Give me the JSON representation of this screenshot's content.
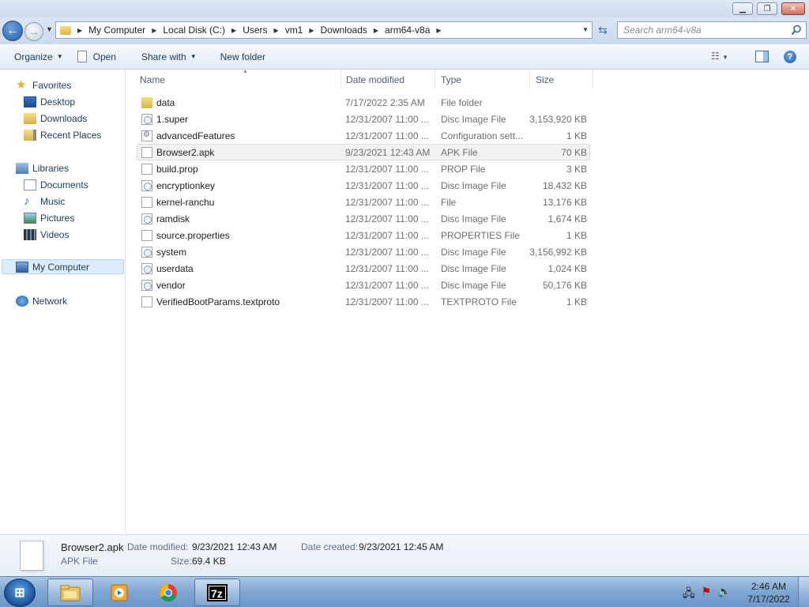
{
  "window": {
    "min_icon": "minimize-icon",
    "max_icon": "restore-icon",
    "close_icon": "close-icon"
  },
  "address": {
    "breadcrumbs": [
      "My Computer",
      "Local Disk (C:)",
      "Users",
      "vm1",
      "Downloads",
      "arm64-v8a"
    ]
  },
  "search": {
    "placeholder": "Search arm64-v8a"
  },
  "toolbar": {
    "organize": "Organize",
    "open": "Open",
    "share_with": "Share with",
    "new_folder": "New folder"
  },
  "nav": {
    "favorites": "Favorites",
    "desktop": "Desktop",
    "downloads": "Downloads",
    "recent_places": "Recent Places",
    "libraries": "Libraries",
    "documents": "Documents",
    "music": "Music",
    "pictures": "Pictures",
    "videos": "Videos",
    "my_computer": "My Computer",
    "network": "Network"
  },
  "columns": {
    "name": "Name",
    "date": "Date modified",
    "type": "Type",
    "size": "Size"
  },
  "files": [
    {
      "name": "data",
      "date": "7/17/2022 2:35 AM",
      "type": "File folder",
      "size": "",
      "icon": "folder-icon"
    },
    {
      "name": "1.super",
      "date": "12/31/2007 11:00 ...",
      "type": "Disc Image File",
      "size": "3,153,920 KB",
      "icon": "disc-image-icon"
    },
    {
      "name": "advancedFeatures",
      "date": "12/31/2007 11:00 ...",
      "type": "Configuration sett...",
      "size": "1 KB",
      "icon": "config-file-icon"
    },
    {
      "name": "Browser2.apk",
      "date": "9/23/2021 12:43 AM",
      "type": "APK File",
      "size": "70 KB",
      "icon": "file-icon"
    },
    {
      "name": "build.prop",
      "date": "12/31/2007 11:00 ...",
      "type": "PROP File",
      "size": "3 KB",
      "icon": "file-icon"
    },
    {
      "name": "encryptionkey",
      "date": "12/31/2007 11:00 ...",
      "type": "Disc Image File",
      "size": "18,432 KB",
      "icon": "disc-image-icon"
    },
    {
      "name": "kernel-ranchu",
      "date": "12/31/2007 11:00 ...",
      "type": "File",
      "size": "13,176 KB",
      "icon": "file-icon"
    },
    {
      "name": "ramdisk",
      "date": "12/31/2007 11:00 ...",
      "type": "Disc Image File",
      "size": "1,674 KB",
      "icon": "disc-image-icon"
    },
    {
      "name": "source.properties",
      "date": "12/31/2007 11:00 ...",
      "type": "PROPERTIES File",
      "size": "1 KB",
      "icon": "file-icon"
    },
    {
      "name": "system",
      "date": "12/31/2007 11:00 ...",
      "type": "Disc Image File",
      "size": "3,156,992 KB",
      "icon": "disc-image-icon"
    },
    {
      "name": "userdata",
      "date": "12/31/2007 11:00 ...",
      "type": "Disc Image File",
      "size": "1,024 KB",
      "icon": "disc-image-icon"
    },
    {
      "name": "vendor",
      "date": "12/31/2007 11:00 ...",
      "type": "Disc Image File",
      "size": "50,176 KB",
      "icon": "disc-image-icon"
    },
    {
      "name": "VerifiedBootParams.textproto",
      "date": "12/31/2007 11:00 ...",
      "type": "TEXTPROTO File",
      "size": "1 KB",
      "icon": "file-icon"
    }
  ],
  "selected_index": 3,
  "details": {
    "name": "Browser2.apk",
    "type": "APK File",
    "date_modified_label": "Date modified:",
    "date_modified": "9/23/2021 12:43 AM",
    "date_created_label": "Date created:",
    "date_created": "9/23/2021 12:45 AM",
    "size_label": "Size:",
    "size": "69.4 KB"
  },
  "taskbar": {
    "clock_time": "2:46 AM",
    "clock_date": "7/17/2022",
    "tray_icons": [
      "network-icon",
      "action-center-icon",
      "volume-icon"
    ]
  },
  "colors": {
    "selection_bg": "#f2f2f2",
    "nav_selected_bg": "#dcecfc",
    "taskbar": "#7fa6d2"
  }
}
